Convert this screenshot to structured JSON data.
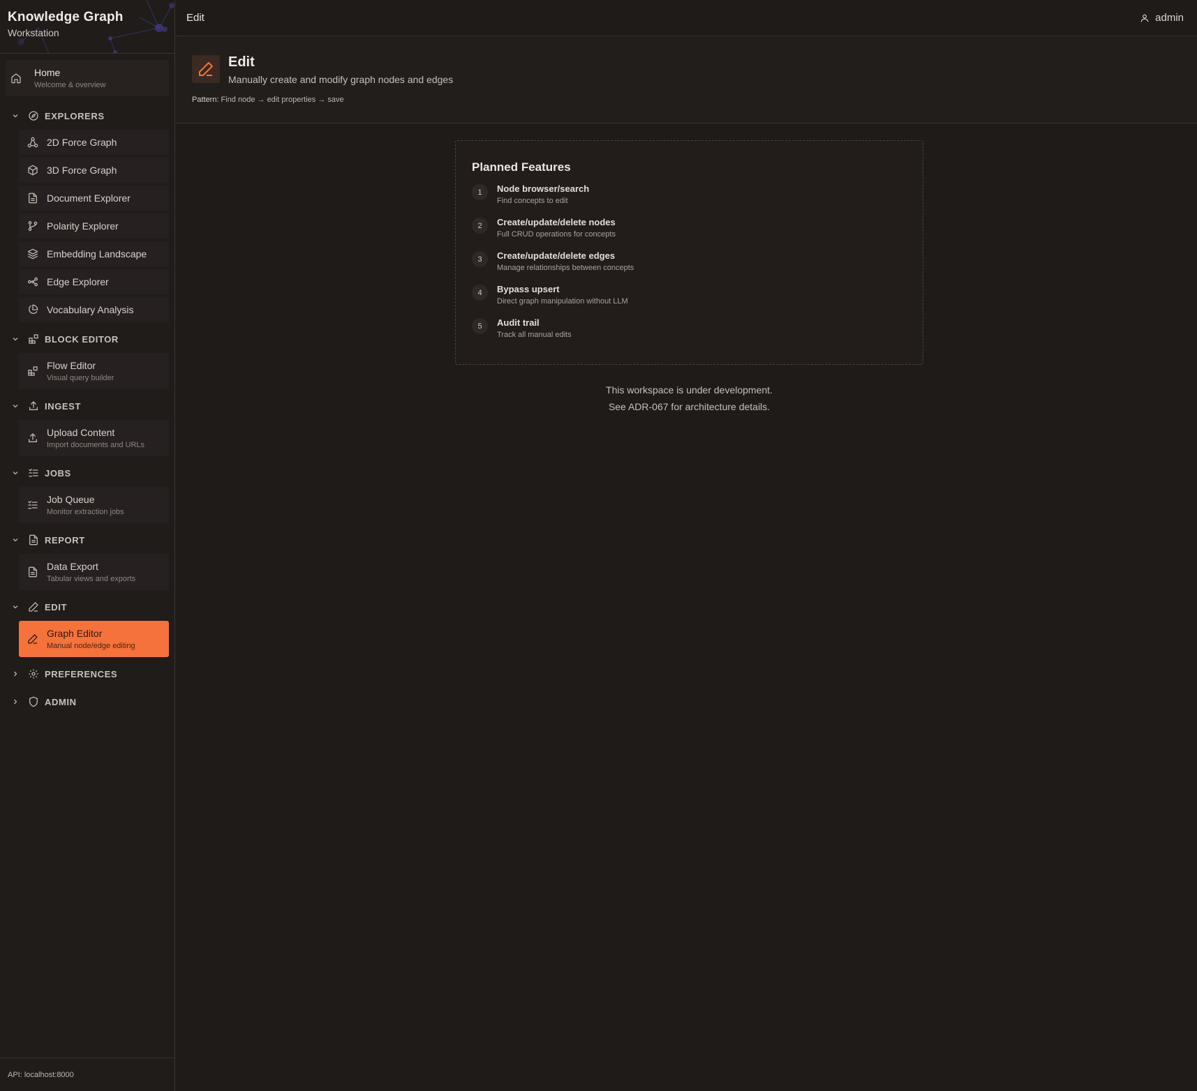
{
  "brand": {
    "title": "Knowledge Graph",
    "subtitle": "Workstation"
  },
  "sidebar": {
    "home": {
      "label": "Home",
      "sub": "Welcome & overview",
      "icon": "home-icon"
    },
    "sections": {
      "explorers": {
        "title": "EXPLORERS",
        "items": [
          {
            "label": "2D Force Graph",
            "icon": "network-icon"
          },
          {
            "label": "3D Force Graph",
            "icon": "cube-icon"
          },
          {
            "label": "Document Explorer",
            "icon": "document-icon"
          },
          {
            "label": "Polarity Explorer",
            "icon": "git-branch-icon"
          },
          {
            "label": "Embedding Landscape",
            "icon": "layers-icon"
          },
          {
            "label": "Edge Explorer",
            "icon": "nodes-icon"
          },
          {
            "label": "Vocabulary Analysis",
            "icon": "pie-chart-icon"
          }
        ]
      },
      "block_editor": {
        "title": "BLOCK EDITOR",
        "items": [
          {
            "label": "Flow Editor",
            "sub": "Visual query builder"
          }
        ]
      },
      "ingest": {
        "title": "INGEST",
        "items": [
          {
            "label": "Upload Content",
            "sub": "Import documents and URLs"
          }
        ]
      },
      "jobs": {
        "title": "JOBS",
        "items": [
          {
            "label": "Job Queue",
            "sub": "Monitor extraction jobs"
          }
        ]
      },
      "report": {
        "title": "REPORT",
        "items": [
          {
            "label": "Data Export",
            "sub": "Tabular views and exports"
          }
        ]
      },
      "edit": {
        "title": "EDIT",
        "items": [
          {
            "label": "Graph Editor",
            "sub": "Manual node/edge editing",
            "active": true
          }
        ]
      },
      "preferences": {
        "title": "PREFERENCES"
      },
      "admin": {
        "title": "ADMIN"
      }
    },
    "api": "API: localhost:8000"
  },
  "topbar": {
    "title": "Edit",
    "user": "admin"
  },
  "header": {
    "title": "Edit",
    "description": "Manually create and modify graph nodes and edges",
    "pattern_label": "Pattern:",
    "pattern_value": "Find node → edit properties → save"
  },
  "features": {
    "title": "Planned Features",
    "items": [
      {
        "num": "1",
        "title": "Node browser/search",
        "desc": "Find concepts to edit"
      },
      {
        "num": "2",
        "title": "Create/update/delete nodes",
        "desc": "Full CRUD operations for concepts"
      },
      {
        "num": "3",
        "title": "Create/update/delete edges",
        "desc": "Manage relationships between concepts"
      },
      {
        "num": "4",
        "title": "Bypass upsert",
        "desc": "Direct graph manipulation without LLM"
      },
      {
        "num": "5",
        "title": "Audit trail",
        "desc": "Track all manual edits"
      }
    ]
  },
  "note": {
    "line1": "This workspace is under development.",
    "line2": "See ADR-067 for architecture details."
  },
  "colors": {
    "accent": "#f5723a",
    "background": "#1f1b19",
    "sidebar": "#201c1a"
  }
}
